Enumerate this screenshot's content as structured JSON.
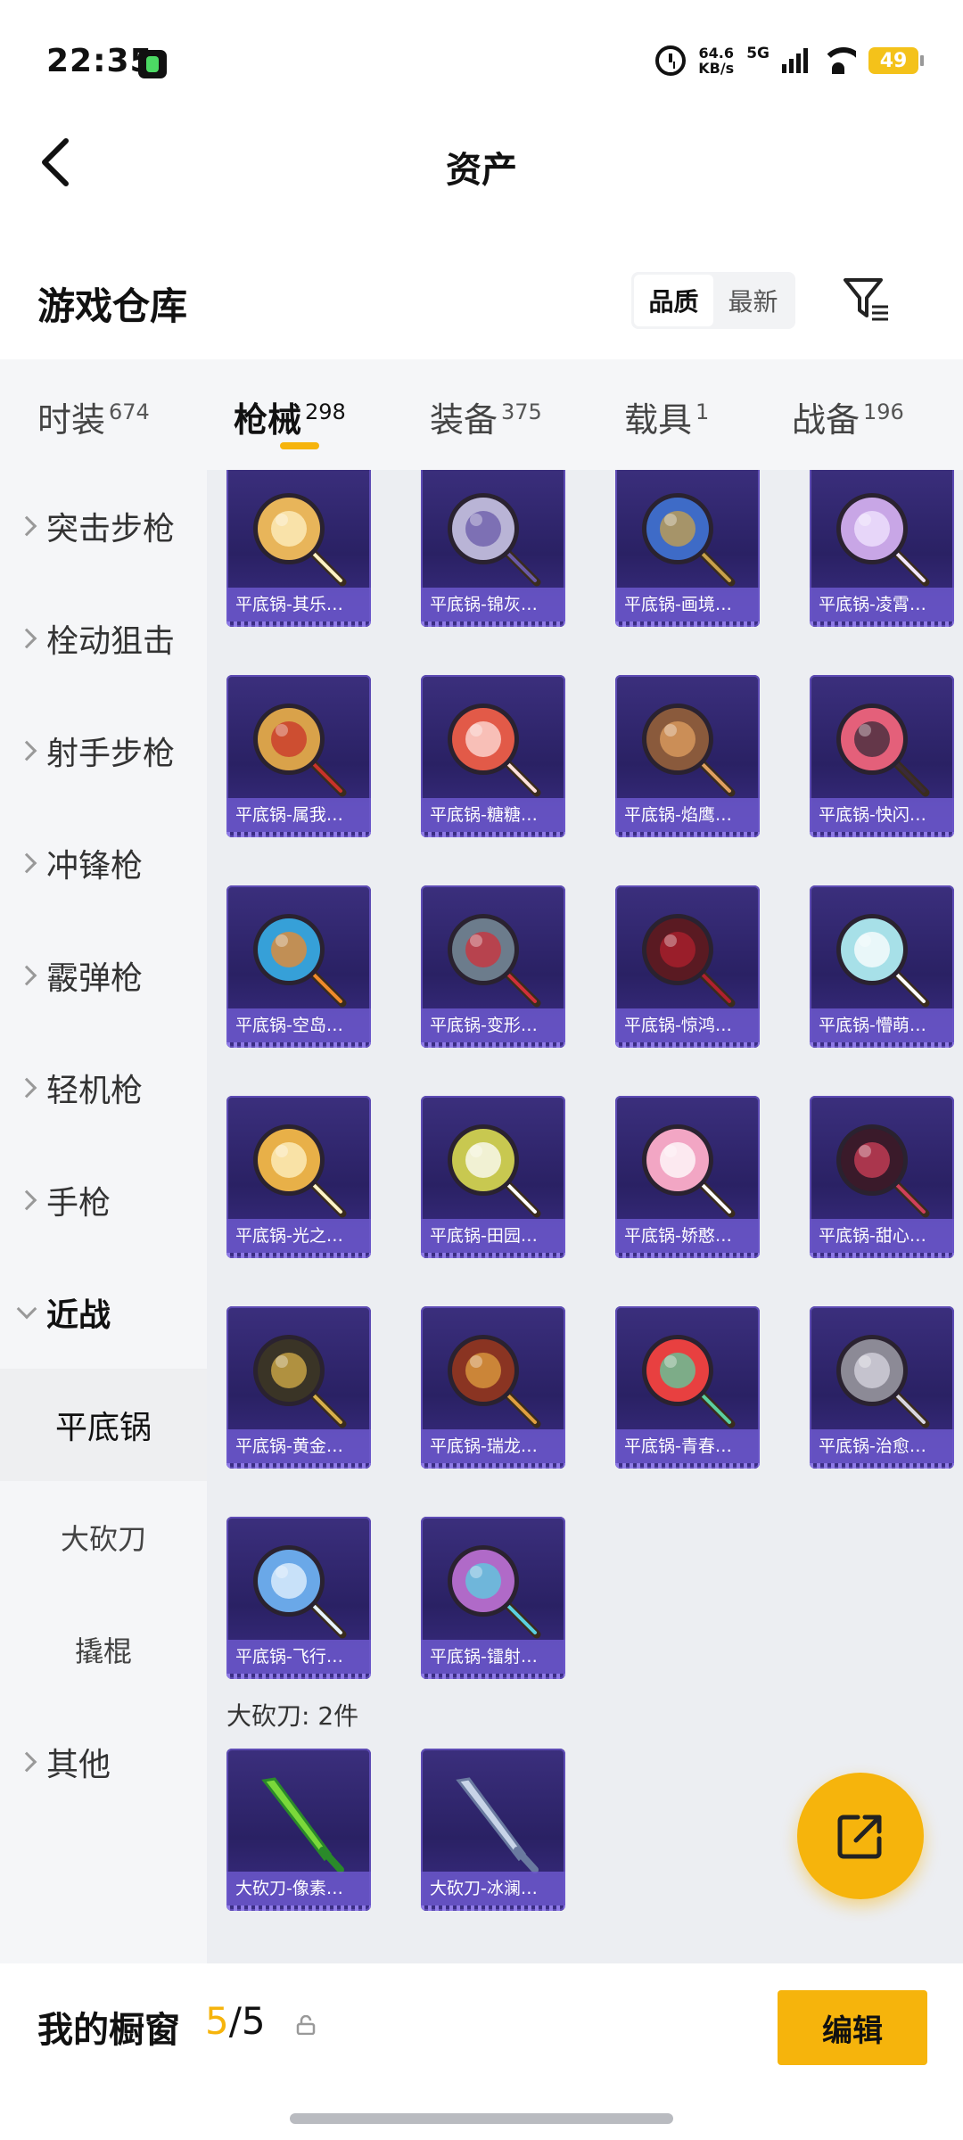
{
  "status_bar": {
    "time": "22:35",
    "net_speed_value": "64.6",
    "net_speed_unit": "KB/s",
    "network": "5G",
    "battery": "49"
  },
  "header": {
    "title": "资产"
  },
  "section": {
    "title": "游戏仓库",
    "sort_options": [
      "品质",
      "最新"
    ],
    "sort_selected": "品质"
  },
  "tabs": [
    {
      "label": "时装",
      "count": "674"
    },
    {
      "label": "枪械",
      "count": "298"
    },
    {
      "label": "装备",
      "count": "375"
    },
    {
      "label": "载具",
      "count": "1"
    },
    {
      "label": "战备",
      "count": "196"
    }
  ],
  "active_tab": "枪械",
  "sidebar": {
    "items": [
      {
        "label": "突击步枪"
      },
      {
        "label": "栓动狙击"
      },
      {
        "label": "射手步枪"
      },
      {
        "label": "冲锋枪"
      },
      {
        "label": "霰弹枪"
      },
      {
        "label": "轻机枪"
      },
      {
        "label": "手枪"
      },
      {
        "label": "近战"
      }
    ],
    "sub_items": [
      {
        "label": "平底锅"
      },
      {
        "label": "大砍刀"
      },
      {
        "label": "撬棍"
      }
    ],
    "selected_sub": "平底锅",
    "tail": {
      "label": "其他"
    }
  },
  "pans": [
    {
      "name": "平底锅-其乐…",
      "color": "#e8b55a",
      "accent": "#fff1c4"
    },
    {
      "name": "平底锅-锦灰…",
      "color": "#b9b4d6",
      "accent": "#6a5aa8"
    },
    {
      "name": "平底锅-画境…",
      "color": "#3e6bc7",
      "accent": "#c9a14a"
    },
    {
      "name": "平底锅-凌霄…",
      "color": "#c8a6e6",
      "accent": "#f2e6ff"
    },
    {
      "name": "平底锅-属我…",
      "color": "#d9a24a",
      "accent": "#c8322a"
    },
    {
      "name": "平底锅-糖糖…",
      "color": "#e25a48",
      "accent": "#ffe1dc"
    },
    {
      "name": "平底锅-焰鹰…",
      "color": "#8a5a3c",
      "accent": "#e0a060"
    },
    {
      "name": "平底锅-快闪…",
      "color": "#e4607a",
      "accent": "#3a2a3a"
    },
    {
      "name": "平底锅-空岛…",
      "color": "#36a0d8",
      "accent": "#f08a2a"
    },
    {
      "name": "平底锅-变形…",
      "color": "#6c7c8c",
      "accent": "#d0303a"
    },
    {
      "name": "平底锅-惊鸿…",
      "color": "#5a1a22",
      "accent": "#b0202e"
    },
    {
      "name": "平底锅-懵萌…",
      "color": "#a7e0e8",
      "accent": "#ffffff"
    },
    {
      "name": "平底锅-光之…",
      "color": "#e8b048",
      "accent": "#fff3c6"
    },
    {
      "name": "平底锅-田园…",
      "color": "#c8c850",
      "accent": "#ffffff"
    },
    {
      "name": "平底锅-娇憨…",
      "color": "#f2a6c4",
      "accent": "#ffffff"
    },
    {
      "name": "平底锅-甜心…",
      "color": "#3a1a2a",
      "accent": "#d0405a"
    },
    {
      "name": "平底锅-黄金…",
      "color": "#3a3426",
      "accent": "#d8b04a"
    },
    {
      "name": "平底锅-瑞龙…",
      "color": "#8a3422",
      "accent": "#e0a040"
    },
    {
      "name": "平底锅-青春…",
      "color": "#e84040",
      "accent": "#5ad0a0"
    },
    {
      "name": "平底锅-治愈…",
      "color": "#8c8a96",
      "accent": "#d8d6e0"
    },
    {
      "name": "平底锅-飞行…",
      "color": "#6aa8e8",
      "accent": "#e8f4ff"
    },
    {
      "name": "平底锅-镭射…",
      "color": "#b06ac8",
      "accent": "#5ad0e0"
    }
  ],
  "knife_group_label": "大砍刀: 2件",
  "knives": [
    {
      "name": "大砍刀-像素…",
      "color": "#7ad83a",
      "accent": "#2a8a2a"
    },
    {
      "name": "大砍刀-冰澜…",
      "color": "#c8d4e8",
      "accent": "#6a7aa0"
    }
  ],
  "bottom_bar": {
    "title": "我的橱窗",
    "count_current": "5",
    "count_total": "/5",
    "edit_label": "编辑"
  },
  "icons": {
    "back": "back-chevron-icon",
    "filter": "filter-icon",
    "share": "share-external-icon",
    "lock": "unlock-icon"
  },
  "colors": {
    "accent": "#f6b40c",
    "card_bg": "#2a2164",
    "card_label": "#6c58cc"
  }
}
